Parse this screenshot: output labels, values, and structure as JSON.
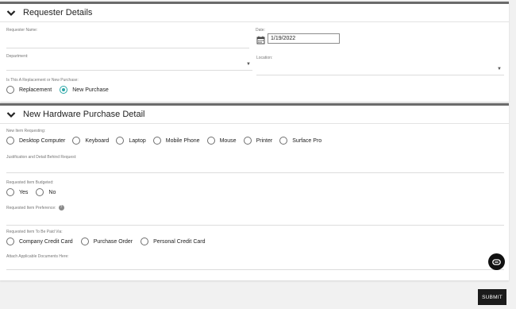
{
  "requester": {
    "title": "Requester Details",
    "name_label": "Requester Name:",
    "date_label": "Date:",
    "date_value": "1/19/2022",
    "department_label": "Department:",
    "location_label": "Location:",
    "replacement_question": "Is This A Replacement or New Purchase:",
    "replacement_options": [
      {
        "label": "Replacement",
        "selected": false
      },
      {
        "label": "New Purchase",
        "selected": true
      }
    ]
  },
  "hardware": {
    "title": "New Hardware Purchase Detail",
    "item_label": "New Item Requesting:",
    "items": [
      {
        "label": "Desktop Computer",
        "selected": false
      },
      {
        "label": "Keyboard",
        "selected": false
      },
      {
        "label": "Laptop",
        "selected": false
      },
      {
        "label": "Mobile Phone",
        "selected": false
      },
      {
        "label": "Mouse",
        "selected": false
      },
      {
        "label": "Printer",
        "selected": false
      },
      {
        "label": "Surface Pro",
        "selected": false
      }
    ],
    "justification_label": "Justification and Detail Behind Request:",
    "budgeted_label": "Requested Item Budgeted:",
    "budgeted_options": [
      {
        "label": "Yes",
        "selected": false
      },
      {
        "label": "No",
        "selected": false
      }
    ],
    "preference_label": "Requested Item Preference:",
    "pay_label": "Requested Item To Be Paid Via:",
    "pay_options": [
      {
        "label": "Company Credit Card",
        "selected": false
      },
      {
        "label": "Purchase Order",
        "selected": false
      },
      {
        "label": "Personal Credit Card",
        "selected": false
      }
    ],
    "attach_label": "Attach Applicable Documents Here:"
  },
  "actions": {
    "submit_label": "SUBMIT"
  },
  "icons": {
    "collapse": "chevron-down-icon",
    "calendar": "calendar-icon",
    "help": "help-icon",
    "chat": "chat-icon"
  },
  "colors": {
    "accent": "#2aa7a7",
    "header_bar": "#6b6b6b",
    "submit_bg": "#1b1b1b"
  }
}
